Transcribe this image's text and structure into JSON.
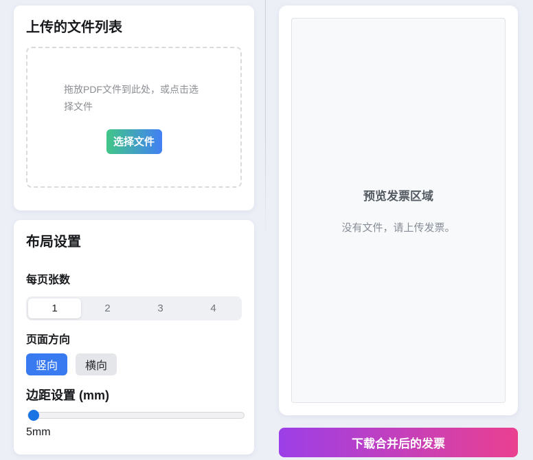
{
  "upload_card": {
    "title": "上传的文件列表",
    "dropzone": {
      "text": "拖放PDF文件到此处，或点击选择文件",
      "button_label": "选择文件"
    }
  },
  "layout_card": {
    "title": "布局设置",
    "per_page": {
      "label": "每页张数",
      "options": [
        "1",
        "2",
        "3",
        "4"
      ],
      "selected": "1"
    },
    "orientation": {
      "label": "页面方向",
      "options": [
        "竖向",
        "横向"
      ],
      "selected": "竖向"
    },
    "margin": {
      "label": "边距设置 (mm)",
      "value": 5,
      "value_text": "5mm"
    }
  },
  "preview_card": {
    "title": "预览发票区域",
    "empty_text": "没有文件，请上传发票。"
  },
  "download": {
    "label": "下载合并后的发票"
  },
  "colors": {
    "page_background": "#edeff7",
    "primary_blue": "#3a7af0",
    "slider_thumb_blue": "#1b74e4",
    "choose_file_gradient_start": "#42c688",
    "choose_file_gradient_end": "#4280f4",
    "download_gradient_start": "#9c3fe8",
    "download_gradient_end": "#ea4090"
  }
}
